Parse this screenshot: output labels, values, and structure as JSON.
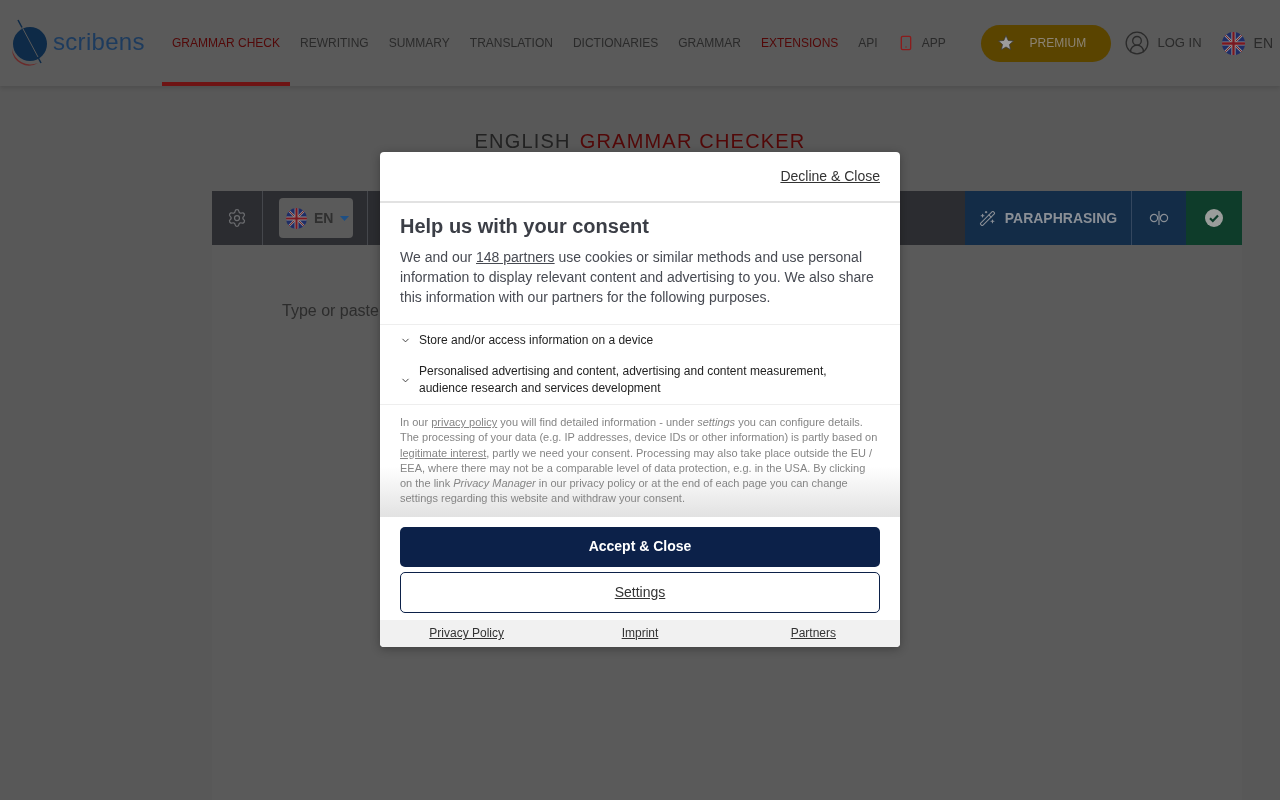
{
  "header": {
    "logo_text": "scribens",
    "nav": [
      {
        "label": "GRAMMAR CHECK",
        "kind": "link",
        "selected": true,
        "highlighted": false
      },
      {
        "label": "REWRITING",
        "kind": "link",
        "selected": false,
        "highlighted": false
      },
      {
        "label": "SUMMARY",
        "kind": "link",
        "selected": false,
        "highlighted": false
      },
      {
        "label": "TRANSLATION",
        "kind": "link",
        "selected": false,
        "highlighted": false
      },
      {
        "label": "DICTIONARIES",
        "kind": "link",
        "selected": false,
        "highlighted": false
      },
      {
        "label": "GRAMMAR",
        "kind": "link",
        "selected": false,
        "highlighted": false
      },
      {
        "label": "EXTENSIONS",
        "kind": "link",
        "selected": false,
        "highlighted": true
      },
      {
        "label": "API",
        "kind": "link",
        "selected": false,
        "highlighted": false
      },
      {
        "label": "APP",
        "kind": "app",
        "selected": false,
        "highlighted": false
      }
    ],
    "premium_button": "PREMIUM",
    "login": "LOG IN",
    "language": "EN"
  },
  "title": [
    {
      "text": "ENGLISH",
      "kind": "plain"
    },
    {
      "text": "GRAMMAR CHECKER",
      "kind": "accent"
    }
  ],
  "toolbar": {
    "language": "EN",
    "paraphrasing_button": "PARAPHRASING"
  },
  "editor": {
    "hint_text": "Type or paste"
  },
  "consent_dialog": {
    "decline_link": "Decline & Close",
    "heading": "Help us with your consent",
    "intro": [
      {
        "kind": "text",
        "text": "We and our "
      },
      {
        "kind": "link",
        "text": "148 partners"
      },
      {
        "kind": "text",
        "text": " use cookies or similar methods and use personal information to display relevant content and advertising to you. We also share this information with our partners for the following purposes."
      }
    ],
    "purposes": [
      {
        "label": "Store and/or access information on a device",
        "expanded": false
      },
      {
        "label": "Personalised advertising and content, advertising and content measurement, audience research and services development",
        "expanded": false
      }
    ],
    "details": [
      {
        "kind": "text",
        "text": "In our "
      },
      {
        "kind": "link",
        "text": "privacy policy"
      },
      {
        "kind": "text",
        "text": " you will find detailed information - under *settings* you can configure details. The processing of your data (e.g. IP addresses, device IDs or other information) is partly based on "
      },
      {
        "kind": "link",
        "text": "legitimate interest"
      },
      {
        "kind": "text",
        "text": ", partly we need your consent. Processing may also take place outside the EU / EEA, where there may not be a comparable level of data protection, e.g. in the USA. By clicking on the link *Privacy Manager* in our privacy policy or at the end of each page you can change settings regarding this website and withdraw your consent."
      }
    ],
    "accept_button": "Accept & Close",
    "settings_button": "Settings",
    "footer_links": [
      "Privacy Policy",
      "Imprint",
      "Partners"
    ]
  }
}
